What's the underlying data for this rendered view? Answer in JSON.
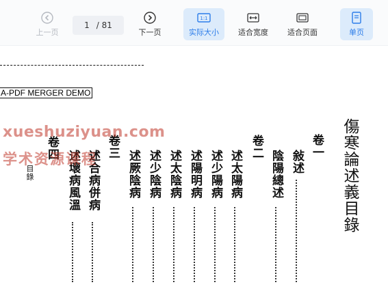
{
  "toolbar": {
    "prev_label": "上一页",
    "next_label": "下一页",
    "page_current": "1",
    "page_total": "/ 81",
    "actual_size_label": "实际大小",
    "fit_width_label": "适合宽度",
    "fit_page_label": "适合页面",
    "single_page_label": "单页",
    "accent_color": "#2b7ce9"
  },
  "document": {
    "demo_banner": "A-PDF MERGER DEMO",
    "title": "傷寒論述義目錄",
    "columns": [
      {
        "text": "卷一"
      },
      {
        "text": "敍述"
      },
      {
        "text": "陰陽總述"
      },
      {
        "text": "卷二"
      },
      {
        "text": "述太陽病"
      },
      {
        "text": "述少陽病"
      },
      {
        "text": "述陽明病"
      },
      {
        "text": "述太陰病"
      },
      {
        "text": "述少陰病"
      },
      {
        "text": "述厥陰病"
      },
      {
        "text": "卷三"
      },
      {
        "text": "述合病併病"
      },
      {
        "text": "述壞病風溫"
      },
      {
        "text": "卷四"
      },
      {
        "text": "目錄"
      }
    ],
    "watermark_line1": "xueshuziyuan.com",
    "watermark_line2": "学术资源课程"
  }
}
